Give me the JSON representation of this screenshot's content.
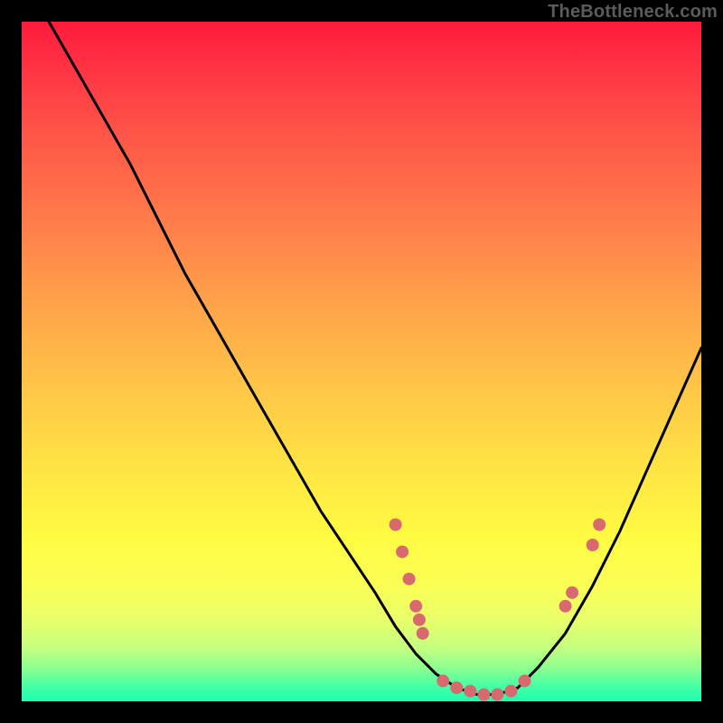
{
  "watermark": "TheBottleneck.com",
  "gradient": {
    "top": "#ff1a3c",
    "mid": "#ffe544",
    "bottom": "#1affb0"
  },
  "chart_data": {
    "type": "line",
    "title": "",
    "xlabel": "",
    "ylabel": "",
    "xlim": [
      0,
      100
    ],
    "ylim": [
      0,
      100
    ],
    "grid": false,
    "series": [
      {
        "name": "curve",
        "x": [
          4,
          8,
          12,
          16,
          20,
          24,
          28,
          32,
          36,
          40,
          44,
          48,
          52,
          55,
          58,
          61,
          64,
          67,
          70,
          73,
          76,
          80,
          84,
          88,
          92,
          96,
          100
        ],
        "y": [
          100,
          93,
          86,
          79,
          71,
          63,
          56,
          49,
          42,
          35,
          28,
          22,
          16,
          11,
          7,
          4,
          2,
          1,
          1,
          2,
          5,
          10,
          17,
          25,
          34,
          43,
          52
        ]
      }
    ],
    "points": [
      {
        "x": 55,
        "y": 26
      },
      {
        "x": 56,
        "y": 22
      },
      {
        "x": 57,
        "y": 18
      },
      {
        "x": 58,
        "y": 14
      },
      {
        "x": 58.5,
        "y": 12
      },
      {
        "x": 59,
        "y": 10
      },
      {
        "x": 62,
        "y": 3
      },
      {
        "x": 64,
        "y": 2
      },
      {
        "x": 66,
        "y": 1.5
      },
      {
        "x": 68,
        "y": 1
      },
      {
        "x": 70,
        "y": 1
      },
      {
        "x": 72,
        "y": 1.5
      },
      {
        "x": 74,
        "y": 3
      },
      {
        "x": 80,
        "y": 14
      },
      {
        "x": 81,
        "y": 16
      },
      {
        "x": 84,
        "y": 23
      },
      {
        "x": 85,
        "y": 26
      }
    ]
  }
}
